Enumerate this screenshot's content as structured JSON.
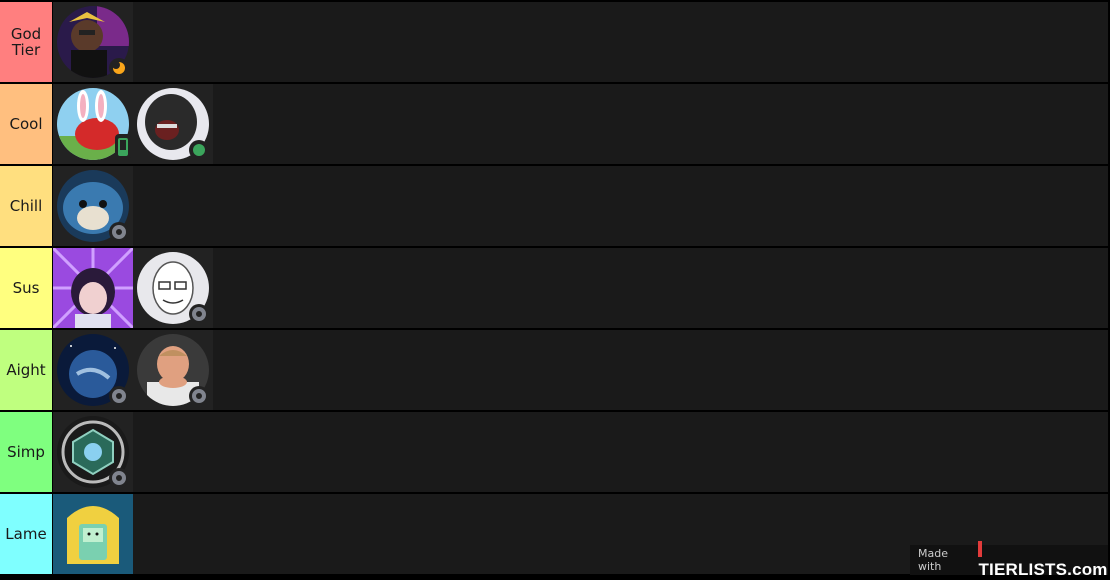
{
  "tiers": [
    {
      "label": "God Tier",
      "color": "#ff7f7f"
    },
    {
      "label": "Cool",
      "color": "#ffbf7f"
    },
    {
      "label": "Chill",
      "color": "#ffdf7f"
    },
    {
      "label": "Sus",
      "color": "#ffff7f"
    },
    {
      "label": "Aight",
      "color": "#bfff7f"
    },
    {
      "label": "Simp",
      "color": "#7fff7f"
    },
    {
      "label": "Lame",
      "color": "#7fffff"
    }
  ],
  "watermark": {
    "made_with": "Made with",
    "logo": "TIERLISTS.com"
  }
}
